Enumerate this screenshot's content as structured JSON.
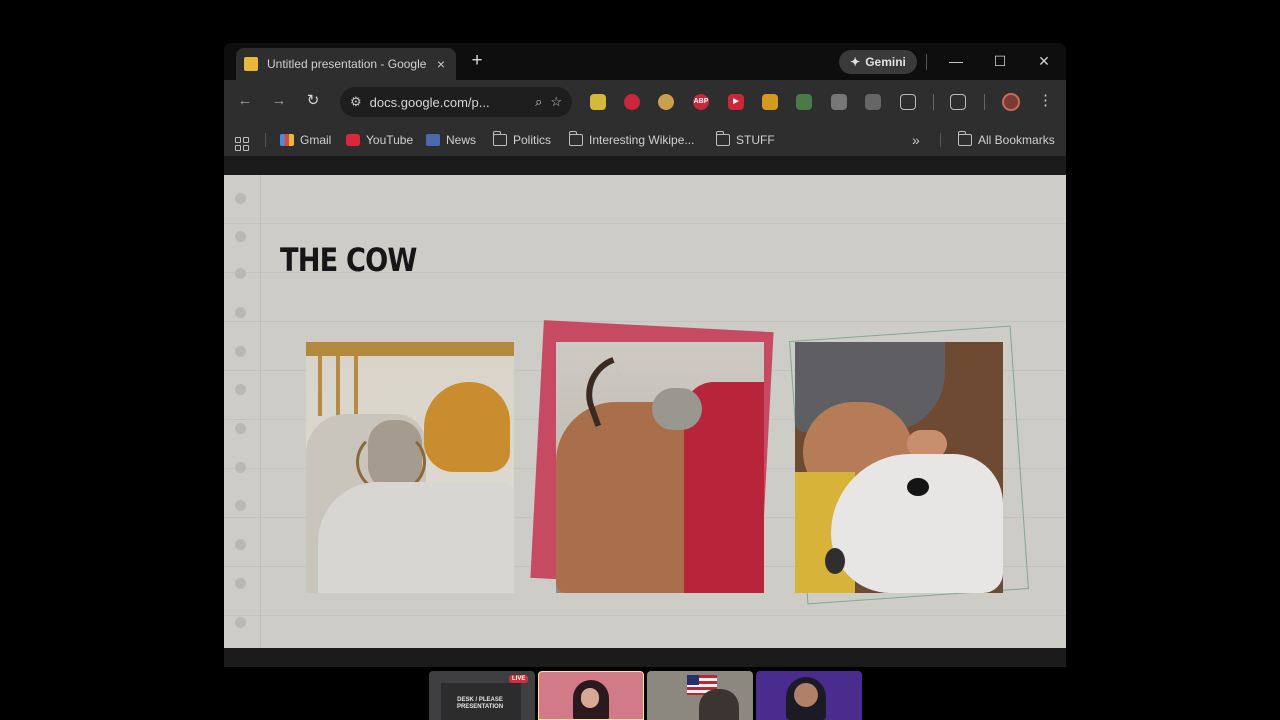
{
  "browser": {
    "tab": {
      "title": "Untitled presentation - Google Slides",
      "close_icon": "×",
      "favicon": "slides-favicon"
    },
    "new_tab_label": "+",
    "gemini_label": "Gemini",
    "window_controls": {
      "minimize": "—",
      "maximize": "☐",
      "close": "✕"
    },
    "toolbar": {
      "back": "←",
      "forward": "→",
      "reload": "↻",
      "url": "docs.google.com/p...",
      "zoom_icon": "🔍",
      "star_icon": "☆",
      "extensions_menu": "⋮"
    },
    "bookmarks": [
      {
        "label": "Gmail",
        "icon": "gmail-icon"
      },
      {
        "label": "YouTube",
        "icon": "youtube-icon"
      },
      {
        "label": "News",
        "icon": "news-icon"
      },
      {
        "label": "Politics",
        "icon": "folder-icon"
      },
      {
        "label": "Interesting Wikipe...",
        "icon": "folder-icon"
      },
      {
        "label": "STUFF",
        "icon": "folder-icon"
      }
    ],
    "bookmarks_overflow": "»",
    "all_bookmarks_label": "All Bookmarks"
  },
  "slide": {
    "title": "THE COW",
    "colors": {
      "background": "#cdccc6",
      "accent_pink": "#c74a63",
      "accent_green": "#7fa98f"
    }
  },
  "participants": {
    "live_badge": "LIVE",
    "screen_text": "DESK / PLEASE PRESENTATION"
  }
}
